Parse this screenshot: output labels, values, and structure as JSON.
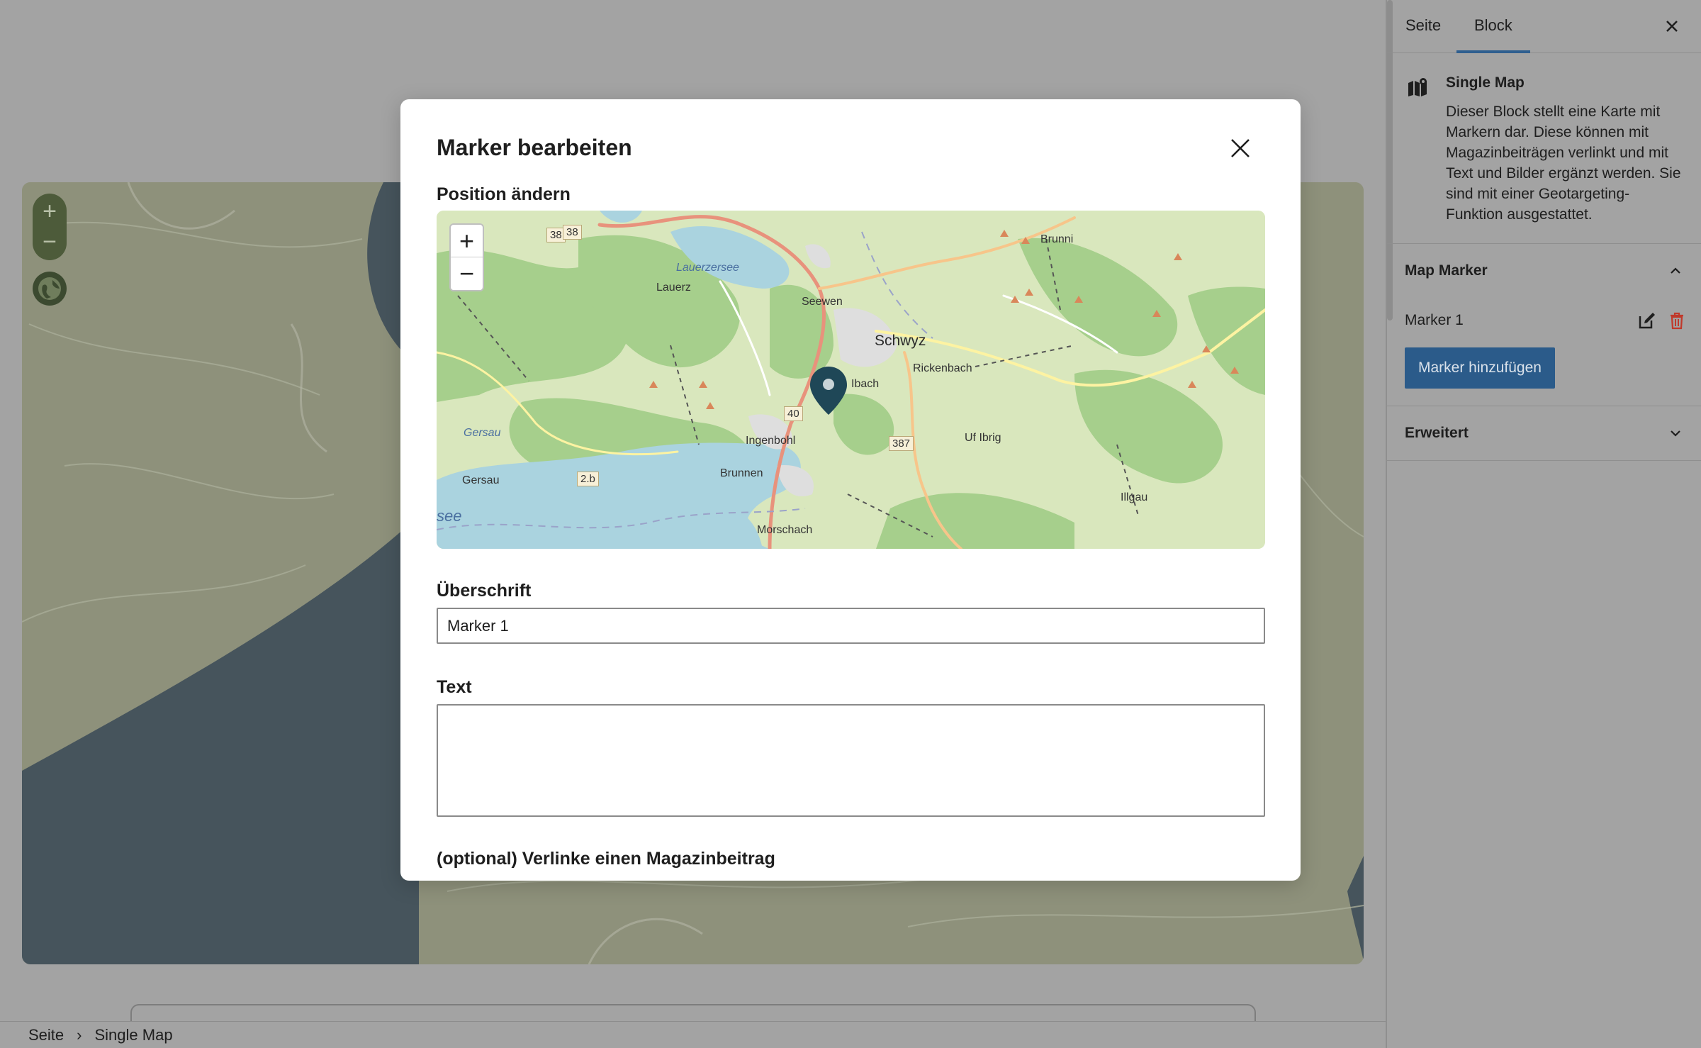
{
  "sidebar": {
    "tabs": [
      {
        "label": "Seite"
      },
      {
        "label": "Block"
      }
    ],
    "block": {
      "title": "Single Map",
      "description": "Dieser Block stellt eine Karte mit Markern dar. Diese können mit Magazinbeiträgen verlinkt und mit Text und Bilder ergänzt werden. Sie sind mit einer Geotargeting-Funktion ausgestattet."
    },
    "map_marker_panel": {
      "title": "Map Marker",
      "markers": [
        {
          "label": "Marker 1"
        }
      ],
      "add_label": "Marker hinzufügen"
    },
    "advanced_panel": {
      "title": "Erweitert"
    }
  },
  "breadcrumb": {
    "items": [
      "Seite",
      "Single Map"
    ],
    "separator": "›"
  },
  "canvas_map": {
    "zoom_in": "+",
    "zoom_out": "−"
  },
  "modal": {
    "title": "Marker bearbeiten",
    "position_label": "Position ändern",
    "map": {
      "zoom_in": "+",
      "zoom_out": "−",
      "places": [
        "Lauerzersee",
        "Lauerz",
        "Seewen",
        "Schwyz",
        "Ibach",
        "Rickenbach",
        "Brunni",
        "Gersau",
        "Ingenbohl",
        "Brunnen",
        "Uf Ibrig",
        "Illgau",
        "Morschach",
        "see"
      ],
      "road_numbers": [
        "38",
        "38",
        "40",
        "387",
        "2.b"
      ]
    },
    "heading_label": "Überschrift",
    "heading_value": "Marker 1",
    "text_label": "Text",
    "text_value": "",
    "link_label": "(optional) Verlinke einen Magazinbeitrag"
  },
  "colors": {
    "accent": "#2b5b8a",
    "pin": "#1f4757",
    "delete": "#c0392b",
    "overlay": "#a3a3a3"
  }
}
